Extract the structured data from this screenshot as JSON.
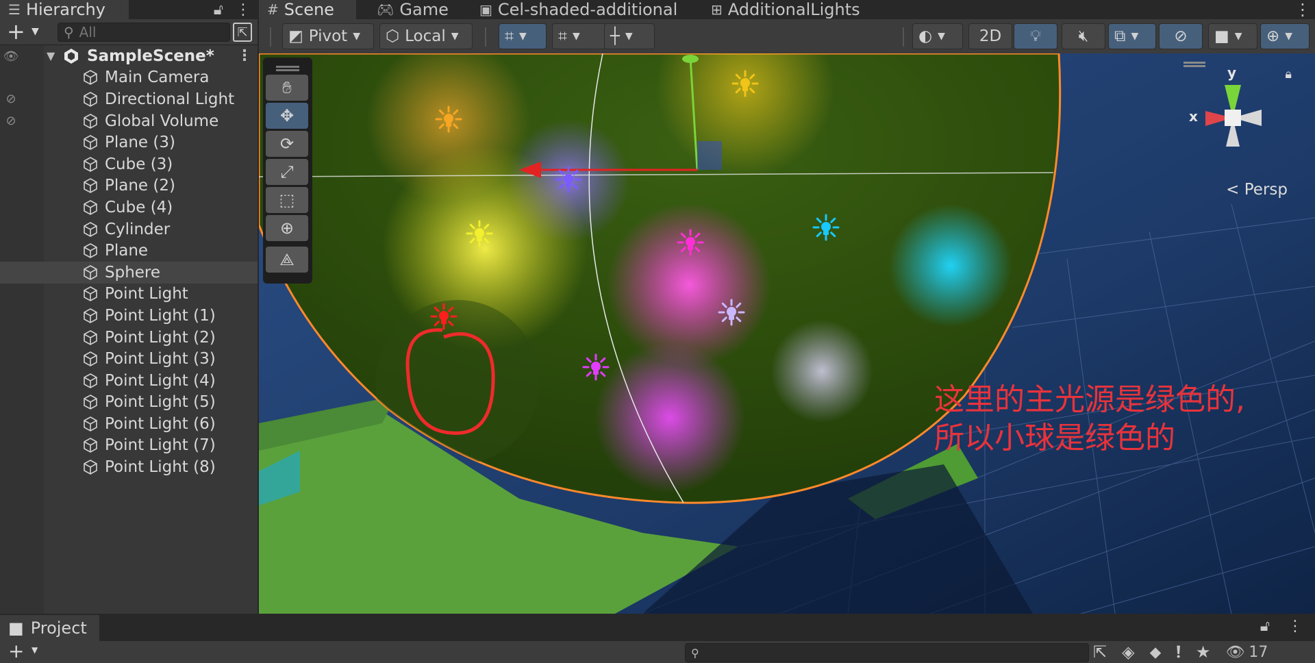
{
  "hierarchy": {
    "tab_label": "Hierarchy",
    "search_placeholder": "All",
    "scene_name": "SampleScene*",
    "objects": [
      "Main Camera",
      "Directional Light",
      "Global Volume",
      "Plane (3)",
      "Cube (3)",
      "Plane (2)",
      "Cube (4)",
      "Cylinder",
      "Plane",
      "Sphere",
      "Point Light",
      "Point Light (1)",
      "Point Light (2)",
      "Point Light (3)",
      "Point Light (4)",
      "Point Light (5)",
      "Point Light (6)",
      "Point Light (7)",
      "Point Light (8)"
    ],
    "selected": "Sphere",
    "hidden_objects": [
      "Directional Light",
      "Global Volume"
    ]
  },
  "scene_tabs": [
    {
      "label": "Scene",
      "icon": "grid-icon"
    },
    {
      "label": "Game",
      "icon": "gamepad-icon"
    },
    {
      "label": "Cel-shaded-additional",
      "icon": "shader-icon"
    },
    {
      "label": "AdditionalLights",
      "icon": "shader-graph-icon"
    }
  ],
  "toolbar": {
    "pivot_label": "Pivot",
    "local_label": "Local",
    "mode_2d_label": "2D"
  },
  "viewport": {
    "projection_label": "Persp",
    "axis_x": "x",
    "axis_y": "y",
    "annotation_line1": "这里的主光源是绿色的,",
    "annotation_line2": "所以小球是绿色的",
    "light_colors": {
      "orange": "#f5a623",
      "gold": "#f0c419",
      "purple": "#7b5cff",
      "yellow": "#f2ef2e",
      "magenta": "#ff2fd6",
      "cyan": "#18c8ff",
      "red": "#ff1e1e",
      "lavender": "#c9b8ff",
      "violet": "#e23cff"
    },
    "annotation_color": "#e8333c"
  },
  "project": {
    "tab_label": "Project",
    "hidden_count": "17"
  }
}
